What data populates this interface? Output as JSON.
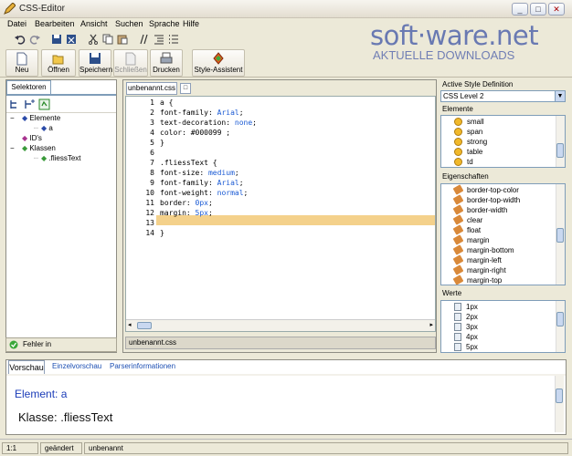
{
  "window": {
    "title": "CSS-Editor",
    "controls": [
      "_",
      "□",
      "✕"
    ]
  },
  "watermark": {
    "brand": "soft·ware.net",
    "tagline": "AKTUELLE DOWNLOADS"
  },
  "menu": [
    "Datei",
    "Bearbeiten",
    "Ansicht",
    "Suchen",
    "Sprache",
    "Hilfe"
  ],
  "toolbar": {
    "small_icons": [
      "undo-icon",
      "redo-icon",
      "save-icon",
      "save-all-icon",
      "cut-icon",
      "copy-icon",
      "paste-icon",
      "comment-icon",
      "indent-icon",
      "list-icon"
    ],
    "buttons": [
      {
        "label": "Neu",
        "icon": "new-file-icon",
        "enabled": true
      },
      {
        "label": "Öffnen",
        "icon": "open-folder-icon",
        "enabled": true
      },
      {
        "label": "Speichern",
        "icon": "save-icon",
        "enabled": true
      },
      {
        "label": "Schließen",
        "icon": "close-file-icon",
        "enabled": false
      },
      {
        "label": "Drucken",
        "icon": "print-icon",
        "enabled": true
      },
      {
        "label": "Style-Assistent",
        "icon": "wizard-icon",
        "enabled": true
      }
    ]
  },
  "selectors": {
    "tab": "Selektoren",
    "tree": [
      {
        "label": "Elemente",
        "level": 0,
        "expander": "−"
      },
      {
        "label": "a",
        "level": 2,
        "expander": ""
      },
      {
        "label": "ID's",
        "level": 1,
        "expander": ""
      },
      {
        "label": "Klassen",
        "level": 0,
        "expander": "−"
      },
      {
        "label": ".fliessText",
        "level": 2,
        "expander": ""
      }
    ],
    "status": "Fehler in"
  },
  "editor": {
    "tab": "unbenannt.css",
    "footer": "unbenannt.css",
    "highlighted_line": 13,
    "lines": [
      "a {",
      "font-family: Arial;",
      "text-decoration: none;",
      "color: #000099 ;",
      "}",
      "",
      ".fliessText {",
      "font-size: medium;",
      "font-family: Arial;",
      "font-weight: normal;",
      "border: 0px;",
      "margin: 5px;",
      "",
      "}"
    ]
  },
  "style_panel": {
    "active_label": "Active Style Definition",
    "active_value": "CSS Level 2",
    "elements_label": "Elemente",
    "elements": [
      "small",
      "span",
      "strong",
      "table",
      "td"
    ],
    "properties_label": "Eigenschaften",
    "properties": [
      "border-top-color",
      "border-top-width",
      "border-width",
      "clear",
      "float",
      "margin",
      "margin-bottom",
      "margin-left",
      "margin-right",
      "margin-top"
    ],
    "values_label": "Werte",
    "values": [
      "1px",
      "2px",
      "3px",
      "4px",
      "5px"
    ]
  },
  "preview": {
    "tabs": [
      "Vorschau",
      "Einzelvorschau",
      "Parserinformationen"
    ],
    "element_line": "Element: a",
    "class_line": "Klasse: .fliessText"
  },
  "statusbar": {
    "position": "1:1",
    "state": "geändert",
    "file": "unbenannt"
  },
  "colors": {
    "highlight": "#f4d18b",
    "value_blue": "#1a5ad4",
    "preview_blue": "#1b3cb8",
    "watermark": "#5366ac"
  }
}
